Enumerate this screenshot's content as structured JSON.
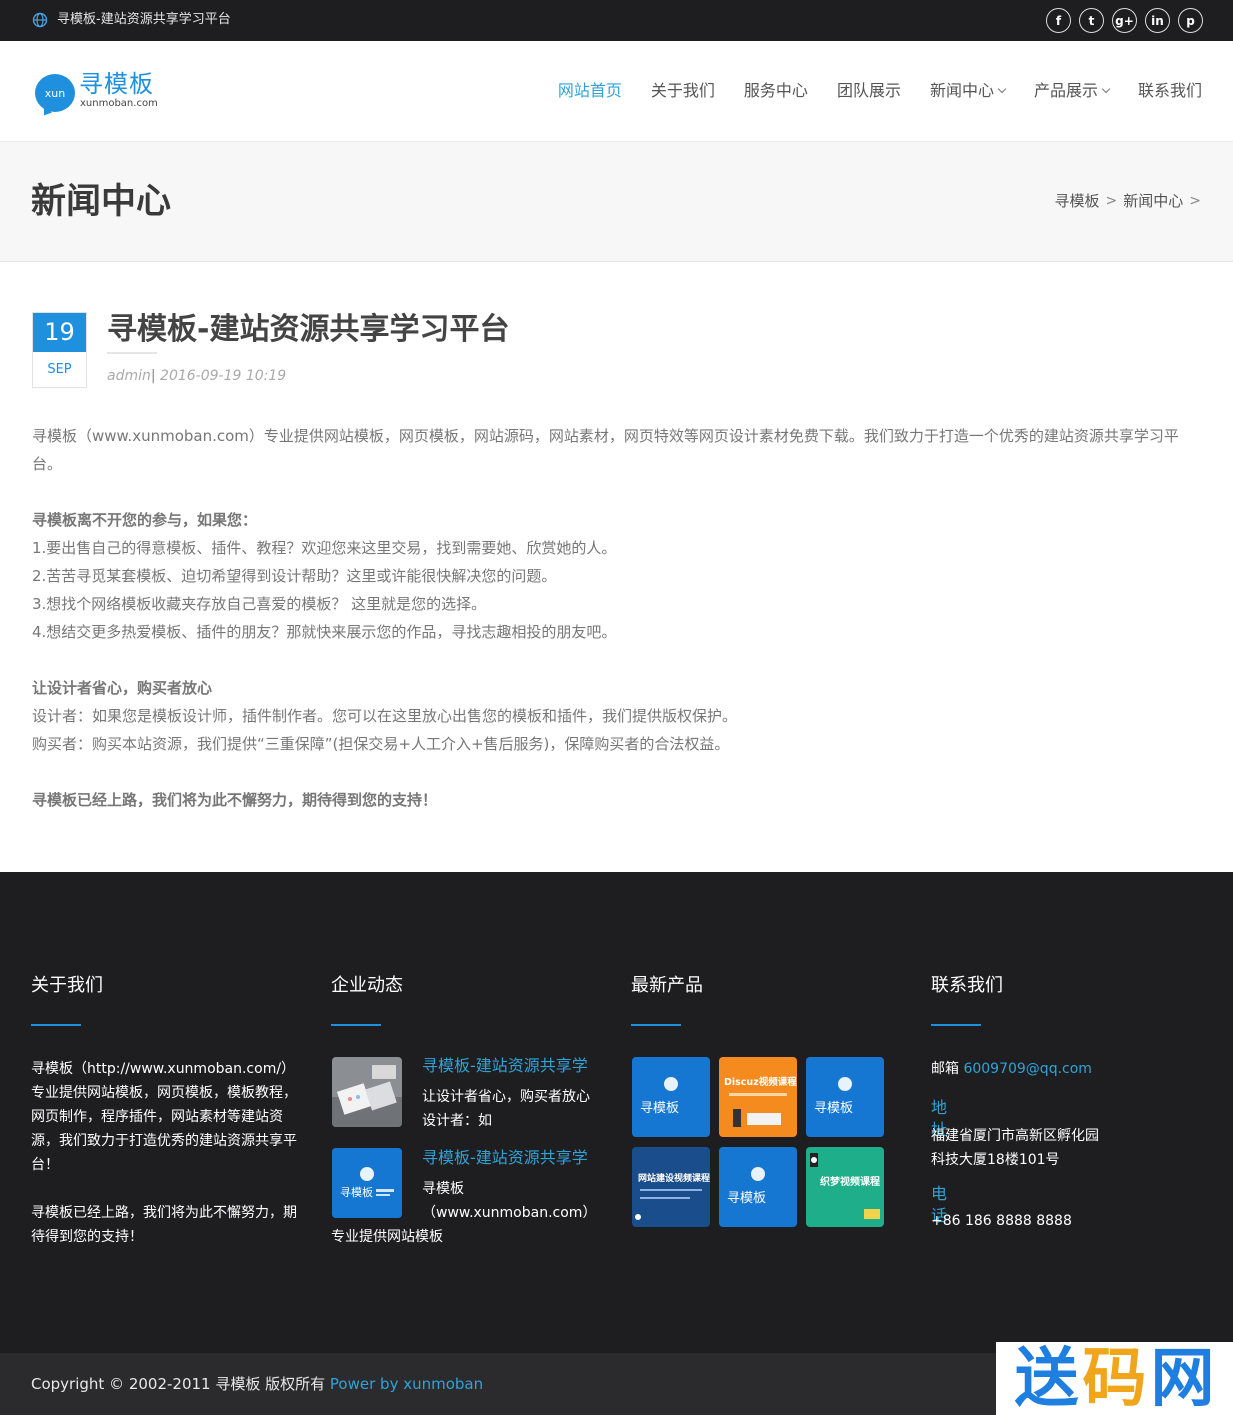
{
  "topbar": {
    "site_title": "寻模板-建站资源共享学习平台",
    "social": [
      {
        "icon": "facebook-icon",
        "glyph": "f"
      },
      {
        "icon": "twitter-icon",
        "glyph": "t"
      },
      {
        "icon": "google-plus-icon",
        "glyph": "g+"
      },
      {
        "icon": "linkedin-icon",
        "glyph": "in"
      },
      {
        "icon": "pinterest-icon",
        "glyph": "p"
      }
    ]
  },
  "header": {
    "logo_badge": "xun",
    "logo_name": "寻模板",
    "logo_sub": "xunmoban.com",
    "nav": [
      {
        "label": "网站首页",
        "active": true,
        "dropdown": false
      },
      {
        "label": "关于我们",
        "active": false,
        "dropdown": false
      },
      {
        "label": "服务中心",
        "active": false,
        "dropdown": false
      },
      {
        "label": "团队展示",
        "active": false,
        "dropdown": false
      },
      {
        "label": "新闻中心",
        "active": false,
        "dropdown": true
      },
      {
        "label": "产品展示",
        "active": false,
        "dropdown": true
      },
      {
        "label": "联系我们",
        "active": false,
        "dropdown": false
      }
    ]
  },
  "band": {
    "title": "新闻中心",
    "breadcrumb": [
      "寻模板",
      ">",
      "新闻中心",
      ">"
    ]
  },
  "article": {
    "day": "19",
    "month": "SEP",
    "title": "寻模板-建站资源共享学习平台",
    "author": "admin",
    "sep": "|",
    "datetime": "2016-09-19 10:19",
    "intro": "寻模板（www.xunmoban.com）专业提供网站模板，网页模板，网站源码，网站素材，网页特效等网页设计素材免费下载。我们致力于打造一个优秀的建站资源共享学习平台。",
    "section1_title": "寻模板离不开您的参与，如果您：",
    "section1_items": [
      "1.要出售自己的得意模板、插件、教程？欢迎您来这里交易，找到需要她、欣赏她的人。",
      "2.苦苦寻觅某套模板、迫切希望得到设计帮助？这里或许能很快解决您的问题。",
      "3.想找个网络模板收藏夹存放自己喜爱的模板？ 这里就是您的选择。",
      "4.想结交更多热爱模板、插件的朋友？那就快来展示您的作品，寻找志趣相投的朋友吧。"
    ],
    "section2_title": "让设计者省心，购买者放心",
    "section2_items": [
      "设计者：如果您是模板设计师，插件制作者。您可以在这里放心出售您的模板和插件，我们提供版权保护。",
      "购买者：购买本站资源，我们提供“三重保障”(担保交易+人工介入+售后服务)，保障购买者的合法权益。"
    ],
    "closing": "寻模板已经上路，我们将为此不懈努力，期待得到您的支持！"
  },
  "footer": {
    "about": {
      "heading": "关于我们",
      "lines": [
        "寻模板（http://www.xunmoban.com/）",
        "专业提供网站模板，网页模板，模板教程，",
        "网页制作，程序插件，网站素材等建站资",
        "源，我们致力于打造优秀的建站资源共享平",
        "台！"
      ],
      "closing_lines": [
        "寻模板已经上路，我们将为此不懈努力，期",
        "待得到您的支持！"
      ]
    },
    "news": {
      "heading": "企业动态",
      "items": [
        {
          "title": "寻模板-建站资源共享学",
          "excerpt": [
            "让设计者省心，购买者放心",
            "设计者：如"
          ]
        },
        {
          "title": "寻模板-建站资源共享学",
          "excerpt": [
            "寻模板",
            "（www.xunmoban.com）",
            "专业提供网站模板"
          ]
        }
      ]
    },
    "products": {
      "heading": "最新产品",
      "items": [
        {
          "label": "寻模板",
          "color": "#1677d2"
        },
        {
          "label": "Discuz视频课程",
          "color": "#f58a1f"
        },
        {
          "label": "寻模板",
          "color": "#1677d2"
        },
        {
          "label": "网站建设视频课程",
          "color": "#1a4d8c"
        },
        {
          "label": "寻模板",
          "color": "#1677d2"
        },
        {
          "label": "织梦视频课程",
          "color": "#1fae8a"
        }
      ]
    },
    "contact": {
      "heading": "联系我们",
      "email_label": "邮箱",
      "email": "6009709@qq.com",
      "address_label": "地址",
      "address_lines": [
        "福建省厦门市高新区孵化园",
        "科技大厦18楼101号"
      ],
      "phone_label": "电话",
      "phone": "+86 186 8888 8888"
    }
  },
  "bottom": {
    "copyright": "Copyright © 2002-2011 寻模板 版权所有",
    "power": "Power by xunmoban"
  },
  "watermark": [
    "送",
    "码",
    "网"
  ],
  "colors": {
    "accent": "#1e90dd",
    "link": "#2fa3d8",
    "dark": "#1e1e20"
  }
}
